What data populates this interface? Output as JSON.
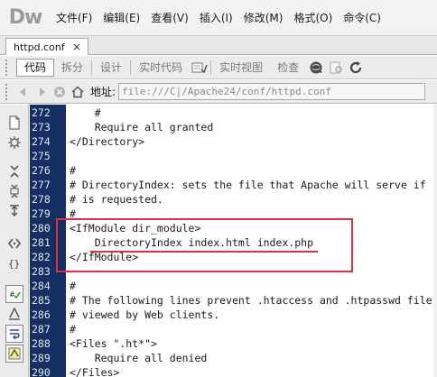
{
  "app": {
    "logo": "Dw"
  },
  "menu": [
    "文件(F)",
    "编辑(E)",
    "查看(V)",
    "插入(I)",
    "修改(M)",
    "格式(O)",
    "命令(C)"
  ],
  "tab": {
    "label": "httpd.conf",
    "close": "×"
  },
  "view_toolbar": {
    "code": "代码",
    "split": "拆分",
    "design": "设计",
    "live_code": "实时代码",
    "live_view": "实时视图",
    "inspect": "检查"
  },
  "address_bar": {
    "label": "地址:",
    "value": "file:///C|/Apache24/conf/httpd.conf"
  },
  "code": {
    "line_numbers": [
      "272",
      "273",
      "274",
      "275",
      "276",
      "277",
      "278",
      "279",
      "280",
      "281",
      "282",
      "283",
      "284",
      "285",
      "286",
      "287",
      "288",
      "289",
      "290"
    ],
    "lines": [
      "    #",
      "    Require all granted",
      "</Directory>",
      "",
      "#",
      "# DirectoryIndex: sets the file that Apache will serve if",
      "# is requested.",
      "#",
      "<IfModule dir_module>",
      "    DirectoryIndex index.html index.php",
      "</IfModule>",
      "",
      "#",
      "# The following lines prevent .htaccess and .htpasswd file",
      "# viewed by Web clients.",
      "#",
      "<Files \".ht*\">",
      "    Require all denied",
      "</Files>"
    ]
  },
  "colors": {
    "gutter": "#132f63",
    "highlight": "#e0303c"
  }
}
